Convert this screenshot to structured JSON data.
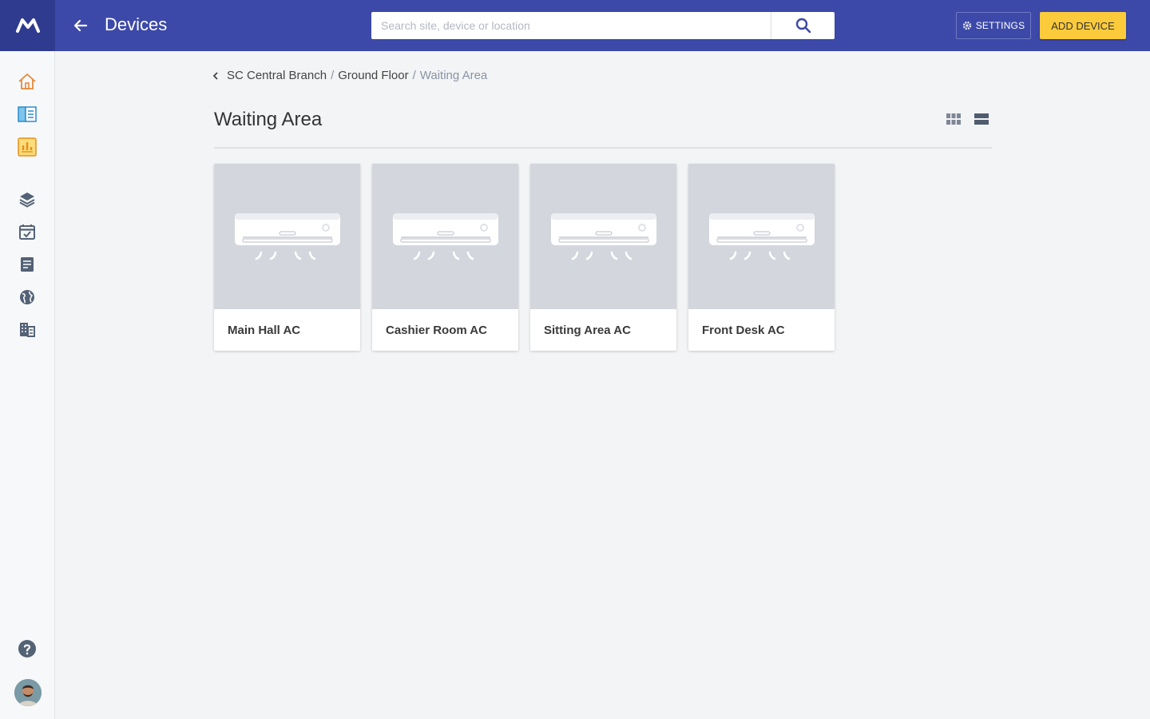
{
  "header": {
    "logo_icon": "brand-m-logo",
    "title": "Devices",
    "search_placeholder": "Search site, device or location",
    "search_value": "",
    "settings_label": "SETTINGS",
    "add_device_label": "ADD DEVICE",
    "colors": {
      "bar": "#3c49a8",
      "accent": "#fccb3c"
    }
  },
  "sidebar": {
    "items": [
      {
        "icon": "home-icon",
        "label": ""
      },
      {
        "icon": "catalog-icon",
        "label": ""
      },
      {
        "icon": "reports-icon",
        "label": ""
      },
      {
        "icon": "layers-icon",
        "label": ""
      },
      {
        "icon": "calendar-check-icon",
        "label": ""
      },
      {
        "icon": "document-icon",
        "label": ""
      },
      {
        "icon": "globe-icon",
        "label": ""
      },
      {
        "icon": "building-icon",
        "label": ""
      }
    ],
    "help_icon": "help-icon",
    "avatar_icon": "user-avatar"
  },
  "breadcrumb": {
    "items": [
      "SC Central Branch",
      "Ground Floor"
    ],
    "separator": "/",
    "current": "Waiting Area"
  },
  "section": {
    "title": "Waiting Area",
    "view_modes": [
      "grid-view-icon",
      "list-view-icon"
    ]
  },
  "devices": [
    {
      "name": "Main Hall AC",
      "icon": "air-conditioner-icon"
    },
    {
      "name": "Cashier Room AC",
      "icon": "air-conditioner-icon"
    },
    {
      "name": "Sitting Area AC",
      "icon": "air-conditioner-icon"
    },
    {
      "name": "Front Desk AC",
      "icon": "air-conditioner-icon"
    }
  ]
}
